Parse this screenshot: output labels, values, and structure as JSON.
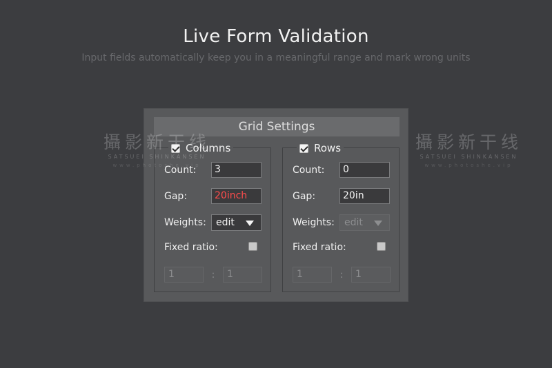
{
  "header": {
    "title": "Live Form Validation",
    "subtitle": "Input fields automatically keep you in a meaningful range and mark wrong units"
  },
  "watermark": {
    "cn": "攝影新干线",
    "en": "SATSUEI SHINKANSEN",
    "url": "www.photoshe.vip"
  },
  "panel": {
    "title": "Grid Settings",
    "columns": {
      "label": "Columns",
      "checked": true,
      "count_label": "Count:",
      "count_value": "3",
      "gap_label": "Gap:",
      "gap_value": "20inch",
      "gap_invalid": true,
      "weights_label": "Weights:",
      "weights_value": "edit",
      "weights_disabled": false,
      "fixed_ratio_label": "Fixed ratio:",
      "fixed_ratio_checked": false,
      "ratio_a": "1",
      "ratio_sep": ":",
      "ratio_b": "1"
    },
    "rows": {
      "label": "Rows",
      "checked": true,
      "count_label": "Count:",
      "count_value": "0",
      "gap_label": "Gap:",
      "gap_value": "20in",
      "gap_invalid": false,
      "weights_label": "Weights:",
      "weights_value": "edit",
      "weights_disabled": true,
      "fixed_ratio_label": "Fixed ratio:",
      "fixed_ratio_checked": false,
      "ratio_a": "1",
      "ratio_sep": ":",
      "ratio_b": "1"
    }
  },
  "colors": {
    "background": "#3c3d40",
    "panel": "#58595b",
    "error_text": "#ff4c4c"
  }
}
